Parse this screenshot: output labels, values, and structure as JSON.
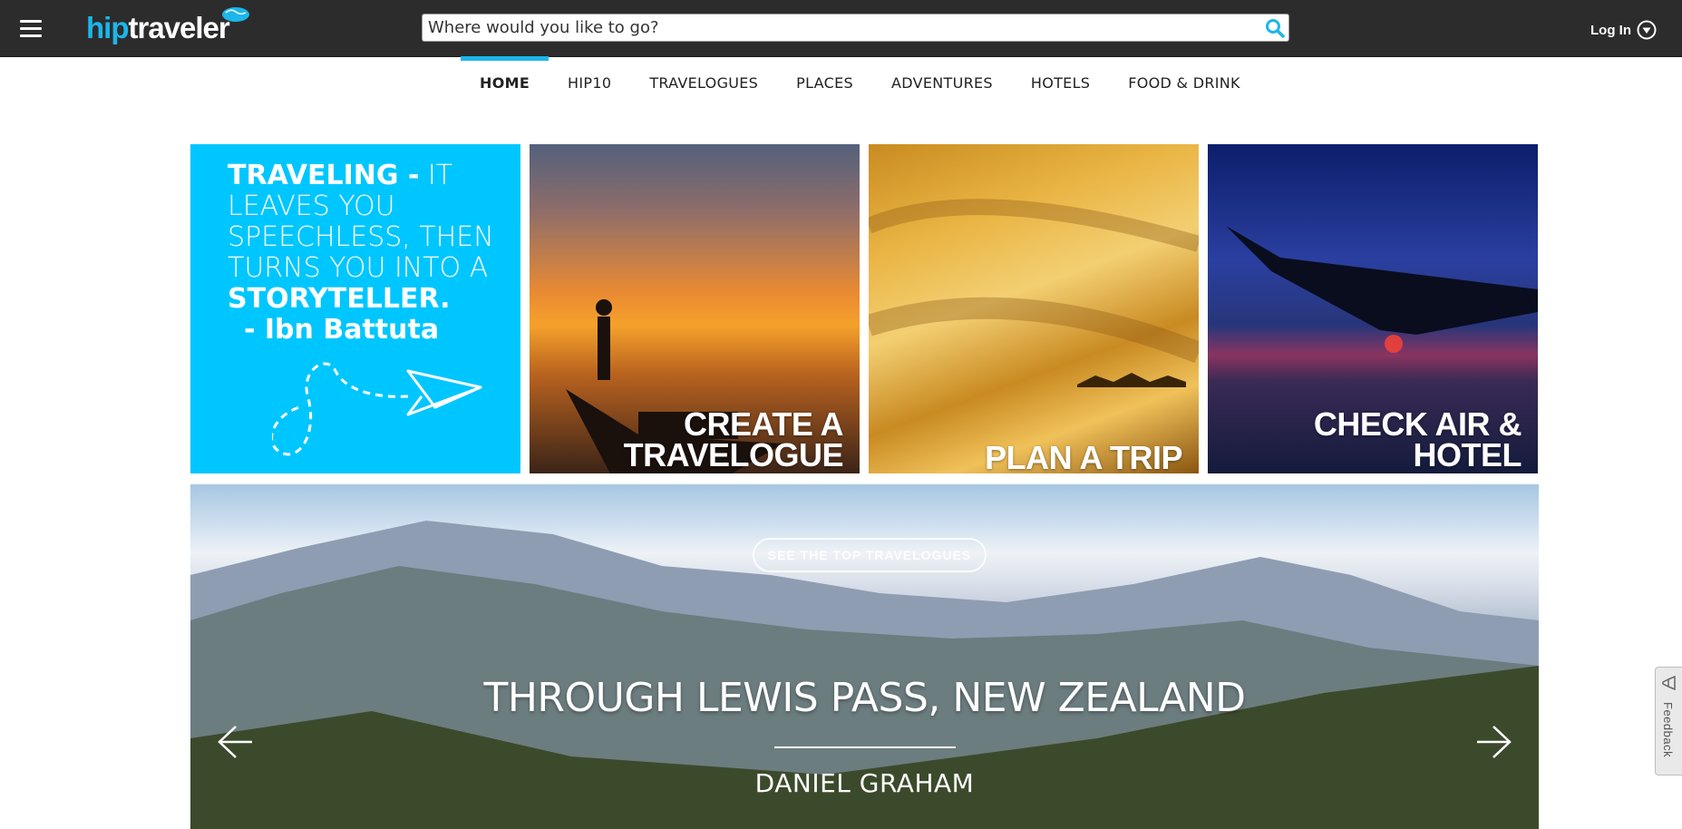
{
  "header": {
    "logo_hip": "hip",
    "logo_traveler": "traveler",
    "search_placeholder": "Where would you like to go?",
    "login_label": "Log In",
    "accent_color": "#1cb6ea"
  },
  "nav": {
    "tabs": [
      {
        "label": "HOME",
        "active": true
      },
      {
        "label": "HIP10"
      },
      {
        "label": "TRAVELOGUES"
      },
      {
        "label": "PLACES"
      },
      {
        "label": "ADVENTURES"
      },
      {
        "label": "HOTELS"
      },
      {
        "label": "FOOD & DRINK"
      }
    ]
  },
  "tiles": {
    "quote": {
      "bold1": "TRAVELING -",
      "text1": " IT LEAVES YOU SPEECHLESS, THEN TURNS YOU INTO A ",
      "bold2": "STORYTELLER.",
      "author": "- Ibn Battuta"
    },
    "create": {
      "line1": "CREATE A",
      "line2": "TRAVELOGUE"
    },
    "plan": {
      "line1": "PLAN A TRIP"
    },
    "check": {
      "line1": "CHECK AIR &",
      "line2": "HOTEL"
    }
  },
  "banner": {
    "cta": "SEE THE TOP TRAVELOGUES",
    "title": "THROUGH LEWIS PASS, NEW ZEALAND",
    "author": "DANIEL GRAHAM"
  },
  "feedback": {
    "label": "Feedback"
  },
  "icons": [
    "menu-icon",
    "globe-icon",
    "search-icon",
    "chevron-down-circle-icon",
    "paper-plane-icon",
    "arrow-left-icon",
    "arrow-right-icon",
    "feedback-icon"
  ]
}
